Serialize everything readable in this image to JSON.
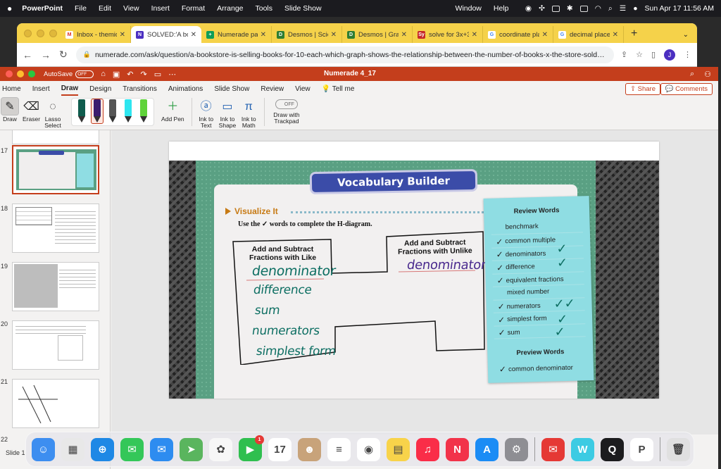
{
  "menubar": {
    "app": "PowerPoint",
    "items": [
      "File",
      "Edit",
      "View",
      "Insert",
      "Format",
      "Arrange",
      "Tools",
      "Slide Show"
    ],
    "right_items": [
      "Window",
      "Help"
    ],
    "datetime": "Sun Apr 17  11:56 AM"
  },
  "browser": {
    "tabs": [
      {
        "title": "Inbox - themid",
        "color": "#ffffff",
        "glyph": "M",
        "glyph_color": "#d93025"
      },
      {
        "title": "SOLVED:'A boo",
        "color": "#4b2fc1",
        "glyph": "N",
        "glyph_color": "#ffffff",
        "active": true
      },
      {
        "title": "Numerade pay",
        "color": "#0f9d58",
        "glyph": "+",
        "glyph_color": "#ffffff"
      },
      {
        "title": "Desmos | Scie",
        "color": "#2f7d32",
        "glyph": "D",
        "glyph_color": "#ffffff"
      },
      {
        "title": "Desmos | Grap",
        "color": "#2f7d32",
        "glyph": "D",
        "glyph_color": "#ffffff"
      },
      {
        "title": "solve for 3x+3",
        "color": "#c62828",
        "glyph": "Sy",
        "glyph_color": "#ffffff"
      },
      {
        "title": "coordinate pla",
        "color": "#ffffff",
        "glyph": "G",
        "glyph_color": "#4285f4"
      },
      {
        "title": "decimal place",
        "color": "#ffffff",
        "glyph": "G",
        "glyph_color": "#4285f4"
      }
    ],
    "url": "numerade.com/ask/question/a-bookstore-is-selling-books-for-10-each-which-graph-shows-the-relationship-between-the-number-of-books-x-the-store-sold-and...",
    "avatar": "J"
  },
  "ppt": {
    "autosave_label": "AutoSave",
    "autosave_state": "OFF",
    "doc_name": "Numerade 4_17",
    "tabs": [
      "Home",
      "Insert",
      "Draw",
      "Design",
      "Transitions",
      "Animations",
      "Slide Show",
      "Review",
      "View",
      "Tell me"
    ],
    "active_tab": "Draw",
    "share_label": "Share",
    "comments_label": "Comments",
    "ribbon": {
      "draw": "Draw",
      "eraser": "Eraser",
      "lasso_1": "Lasso",
      "lasso_2": "Select",
      "add_pen": "Add Pen",
      "ink_text_1": "Ink to",
      "ink_text_2": "Text",
      "ink_shape_1": "Ink to",
      "ink_shape_2": "Shape",
      "ink_math_1": "Ink to",
      "ink_math_2": "Math",
      "trackpad_toggle": "OFF",
      "trackpad_1": "Draw with",
      "trackpad_2": "Trackpad"
    },
    "pens": [
      {
        "color": "#0f5c4d"
      },
      {
        "color": "#3b1d6e",
        "selected": true
      },
      {
        "color": "#555555"
      },
      {
        "color": "#2ee6f0"
      },
      {
        "color": "#5fd33a"
      }
    ],
    "slide_numbers": [
      "17",
      "18",
      "19",
      "20",
      "21",
      "22"
    ],
    "status": "Slide 1"
  },
  "slide": {
    "banner": "Vocabulary Builder",
    "visualize": "Visualize It",
    "instruction": "Use the ✓ words to complete the H-diagram.",
    "left_heading_1": "Add and Subtract",
    "left_heading_2": "Fractions with Like",
    "right_heading_1": "Add and Subtract",
    "right_heading_2": "Fractions with Unlike",
    "handwritten_left": [
      "denominator",
      "difference",
      "sum",
      "numerators",
      "simplest form"
    ],
    "handwritten_right": "denominators",
    "review_title": "Review Words",
    "review_words": [
      {
        "text": "benchmark",
        "check": false
      },
      {
        "text": "common multiple",
        "check": true
      },
      {
        "text": "denominators",
        "check": true
      },
      {
        "text": "difference",
        "check": true
      },
      {
        "text": "equivalent fractions",
        "check": true
      },
      {
        "text": "mixed number",
        "check": false
      },
      {
        "text": "numerators",
        "check": true
      },
      {
        "text": "simplest form",
        "check": true
      },
      {
        "text": "sum",
        "check": true
      }
    ],
    "preview_title": "Preview Words",
    "preview_words": [
      {
        "text": "common denominator",
        "check": true
      }
    ]
  },
  "dock": [
    {
      "name": "finder-icon",
      "color": "#3d8ef0",
      "glyph": "☺"
    },
    {
      "name": "launchpad-icon",
      "color": "#e8e8e8",
      "glyph": "▦"
    },
    {
      "name": "safari-icon",
      "color": "#1e88e5",
      "glyph": "⊕"
    },
    {
      "name": "messages-icon",
      "color": "#34c759",
      "glyph": "✉"
    },
    {
      "name": "mail-icon",
      "color": "#2d8cf0",
      "glyph": "✉"
    },
    {
      "name": "maps-icon",
      "color": "#5ab55e",
      "glyph": "➤"
    },
    {
      "name": "photos-icon",
      "color": "#f7f7f7",
      "glyph": "✿"
    },
    {
      "name": "facetime-icon",
      "color": "#2fbf4f",
      "glyph": "▶",
      "badge": "1"
    },
    {
      "name": "calendar-icon",
      "color": "#ffffff",
      "glyph": "17"
    },
    {
      "name": "contacts-icon",
      "color": "#c8a37a",
      "glyph": "☻"
    },
    {
      "name": "reminders-icon",
      "color": "#ffffff",
      "glyph": "≡"
    },
    {
      "name": "chrome-icon",
      "color": "#ffffff",
      "glyph": "◉"
    },
    {
      "name": "notes-icon",
      "color": "#f8d34a",
      "glyph": "▤"
    },
    {
      "name": "music-icon",
      "color": "#fa2d48",
      "glyph": "♫"
    },
    {
      "name": "news-icon",
      "color": "#f2334a",
      "glyph": "N"
    },
    {
      "name": "app-store-icon",
      "color": "#1b8cf5",
      "glyph": "A"
    },
    {
      "name": "system-preferences-icon",
      "color": "#8e8e93",
      "glyph": "⚙"
    },
    {
      "name": "mail-red-icon",
      "color": "#e53935",
      "glyph": "✉"
    },
    {
      "name": "word-icon",
      "color": "#3ccbe3",
      "glyph": "W"
    },
    {
      "name": "quicktime-icon",
      "color": "#1c1c1e",
      "glyph": "Q"
    },
    {
      "name": "powerpoint-icon",
      "color": "#ffffff",
      "glyph": "P"
    },
    {
      "name": "trash-icon",
      "color": "#e0e0e0",
      "glyph": "🗑"
    }
  ]
}
